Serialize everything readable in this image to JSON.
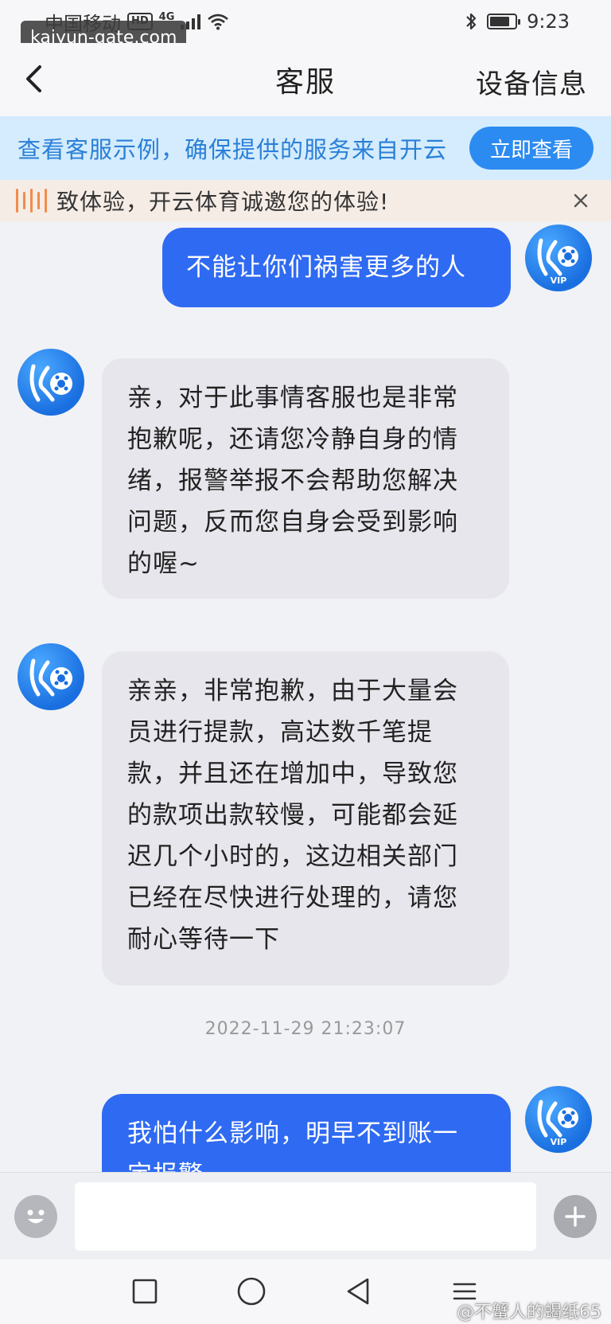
{
  "status_bar": {
    "carrier": "中国移动",
    "hd": "HD",
    "network": "4G",
    "time": "9:23"
  },
  "watermark_top": "kaiyun-gate.com",
  "header": {
    "title": "客服",
    "device_info": "设备信息"
  },
  "notice": {
    "text": "查看客服示例，确保提供的服务来自开云",
    "button": "立即查看"
  },
  "marquee": {
    "text": "致体验，开云体育诚邀您的体验!"
  },
  "messages": [
    {
      "side": "out",
      "lines": [
        "不能让你们祸害更多的人"
      ],
      "avatar_badge": "VIP"
    },
    {
      "side": "in",
      "lines": [
        "亲，对于此事情客服也是非常",
        "抱歉呢，还请您冷静自身的情",
        "绪，报警举报不会帮助您解决",
        "问题，反而您自身会受到影响",
        "的喔~"
      ]
    },
    {
      "side": "in",
      "lines": [
        "亲亲，非常抱歉，由于大量会",
        "员进行提款，高达数千笔提",
        "款，并且还在增加中，导致您",
        "的款项出款较慢，可能都会延",
        "迟几个小时的，这边相关部门",
        "已经在尽快进行处理的，请您",
        "耐心等待一下"
      ]
    },
    {
      "side": "out",
      "lines": [
        "我怕什么影响，明早不到账一",
        "定报警"
      ],
      "avatar_badge": "VIP"
    }
  ],
  "timestamp": "2022-11-29 21:23:07",
  "input": {
    "placeholder": ""
  },
  "watermark_bottom": "不蟹人的蝎纸65",
  "colors": {
    "accent_blue": "#2f6af2",
    "notice_bg": "#d4ecfd",
    "notice_text": "#2a7fd8",
    "marquee_bg": "#f5ece6",
    "incoming_bubble": "#e6e6ec"
  }
}
